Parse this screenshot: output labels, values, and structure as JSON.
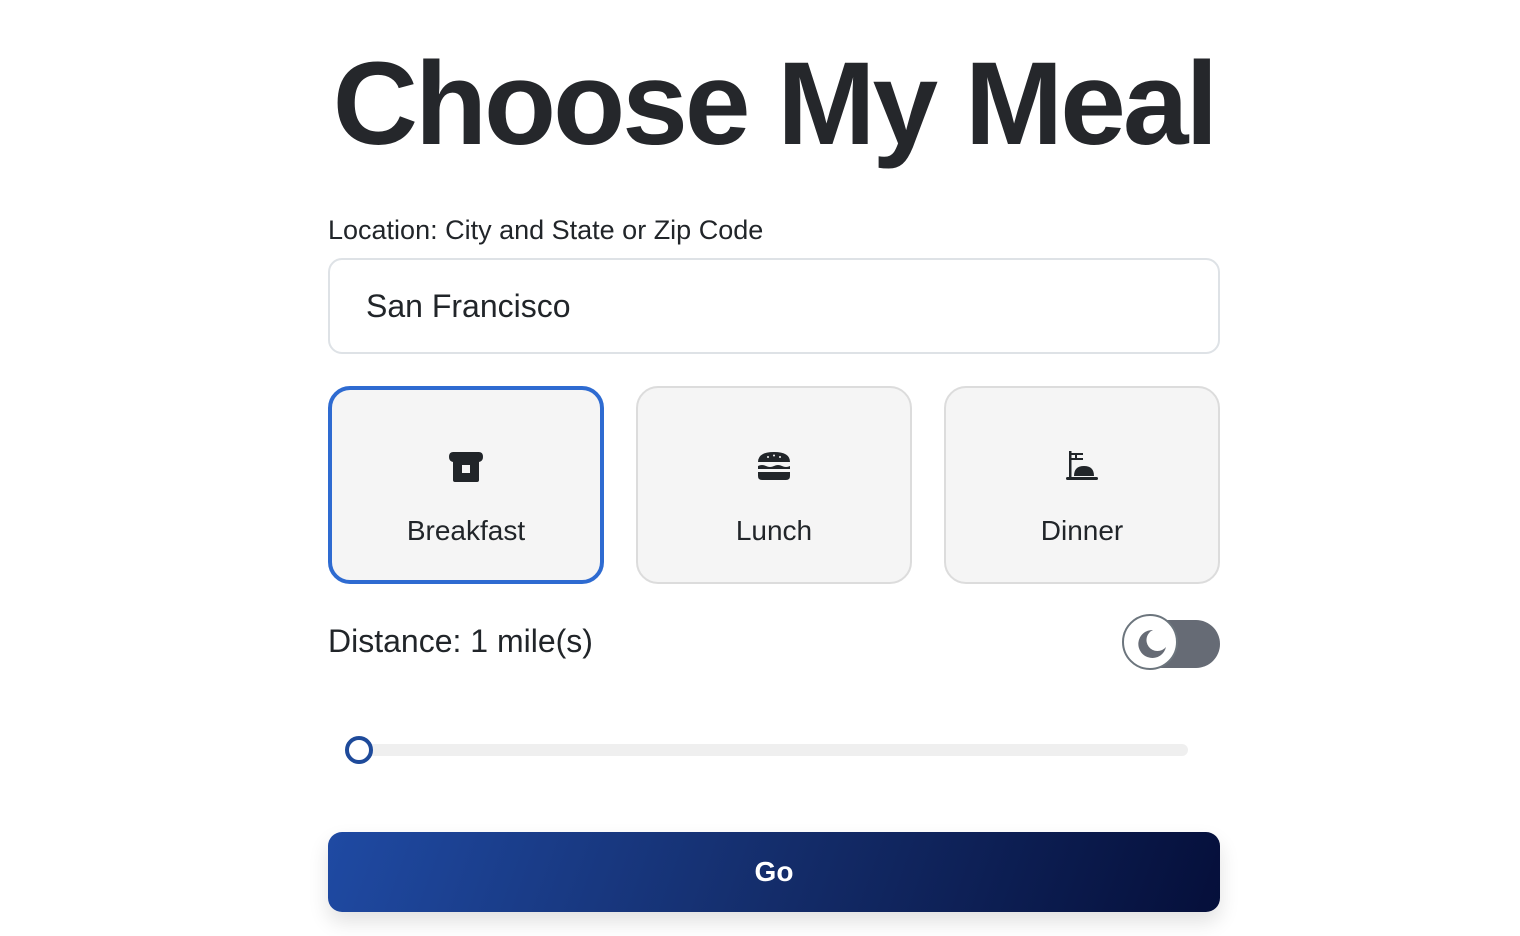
{
  "header": {
    "title": "Choose My Meal"
  },
  "location": {
    "label": "Location: City and State or Zip Code",
    "value": "San Francisco"
  },
  "meals": [
    {
      "label": "Breakfast",
      "icon": "bread-icon",
      "selected": true
    },
    {
      "label": "Lunch",
      "icon": "burger-icon",
      "selected": false
    },
    {
      "label": "Dinner",
      "icon": "plate-icon",
      "selected": false
    }
  ],
  "distance": {
    "label": "Distance: 1 mile(s)",
    "value": 1
  },
  "theme_toggle": {
    "icon": "moon-icon",
    "enabled": false
  },
  "actions": {
    "go_label": "Go"
  },
  "colors": {
    "selected_border": "#2e6bd1",
    "button_gradient_start": "#1f4aa3",
    "button_gradient_end": "#050f3a",
    "toggle_track": "#666b75"
  }
}
